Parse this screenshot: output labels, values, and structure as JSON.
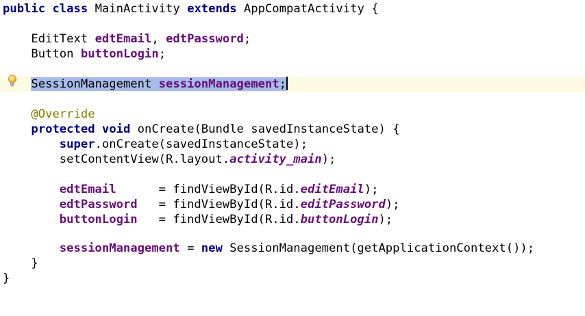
{
  "editor": {
    "file": "MainActivity",
    "current_line": "SessionManagement sessionManagement;",
    "lines": {
      "l1": {
        "kw_public": "public",
        "kw_class": "class",
        "name": "MainActivity",
        "kw_extends": "extends",
        "super": "AppCompatActivity",
        "brace": "{"
      },
      "l2": {
        "type": "EditText",
        "f1": "edtEmail",
        "comma": ",",
        "f2": "edtPassword",
        "semi": ";"
      },
      "l3": {
        "type": "Button",
        "f1": "buttonLogin",
        "semi": ";"
      },
      "l4": {
        "type": "SessionManagement",
        "f1": "sessionManagement",
        "semi": ";"
      },
      "l5": {
        "annotation": "@Override"
      },
      "l6": {
        "kw_protected": "protected",
        "kw_void": "void",
        "rest": "onCreate(Bundle savedInstanceState) {"
      },
      "l7": {
        "kw_super": "super",
        "rest": ".onCreate(savedInstanceState);"
      },
      "l8": {
        "pre": "setContentView(R.layout.",
        "const": "activity_main",
        "post": ");"
      },
      "l9": {
        "field": "edtEmail",
        "pre": "      = findViewById(R.id.",
        "const": "editEmail",
        "post": ");"
      },
      "l10": {
        "field": "edtPassword",
        "pre": "   = findViewById(R.id.",
        "const": "editPassword",
        "post": ");"
      },
      "l11": {
        "field": "buttonLogin",
        "pre": "   = findViewById(R.id.",
        "const": "buttonLogin",
        "post": ");"
      },
      "l12": {
        "field": "sessionManagement",
        "mid": " = ",
        "kw_new": "new",
        "post": " SessionManagement(getApplicationContext());"
      },
      "l13": {
        "brace": "}"
      },
      "l14": {
        "brace": "}"
      }
    },
    "colors": {
      "keyword": "#000080",
      "field": "#660e7a",
      "annotation": "#808000",
      "selection": "#a6bbe8",
      "current_line": "#fdfbe3"
    },
    "gutter_icon": "lightbulb-icon"
  }
}
